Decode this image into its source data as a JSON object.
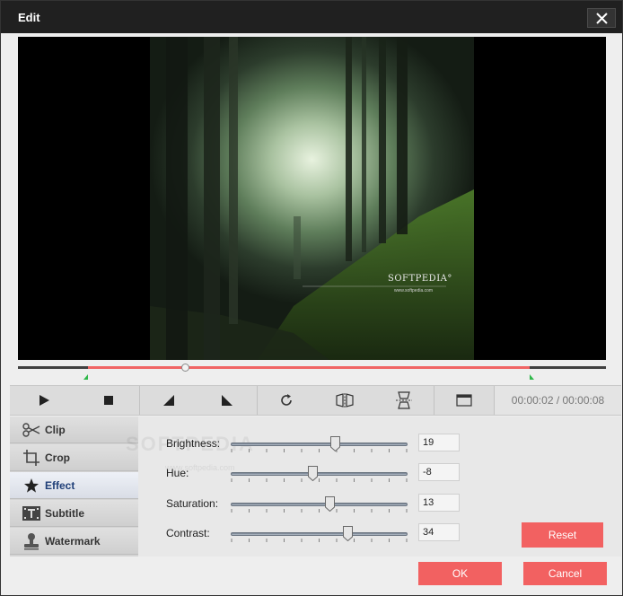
{
  "window": {
    "title": "Edit"
  },
  "preview": {
    "watermark_brand": "SOFTPEDIA°",
    "watermark_url": "www.softpedia.com"
  },
  "timeline": {
    "playhead_fraction": 0.284,
    "start_fraction": 0.119,
    "end_fraction": 0.87
  },
  "toolbar": {
    "buttons": [
      "play-icon",
      "stop-icon",
      "rotate-left-wedge-icon",
      "rotate-right-wedge-icon",
      "rotate-clockwise-icon",
      "flip-horizontal-icon",
      "flip-vertical-icon",
      "aspect-window-icon"
    ],
    "time_display": "00:00:02 / 00:00:08"
  },
  "tabs": [
    {
      "label": "Clip",
      "icon": "scissors-icon"
    },
    {
      "label": "Crop",
      "icon": "crop-icon"
    },
    {
      "label": "Effect",
      "icon": "star-icon",
      "active": true
    },
    {
      "label": "Subtitle",
      "icon": "subtitle-icon"
    },
    {
      "label": "Watermark",
      "icon": "stamp-icon"
    }
  ],
  "effects": {
    "panel_watermark": "SOFTPEDIA",
    "panel_watermark_url": "www.softpedia.com",
    "range": [
      -100,
      100
    ],
    "brightness": {
      "label": "Brightness:",
      "value": "19"
    },
    "hue": {
      "label": "Hue:",
      "value": "-8"
    },
    "saturation": {
      "label": "Saturation:",
      "value": "13"
    },
    "contrast": {
      "label": "Contrast:",
      "value": "34"
    }
  },
  "buttons": {
    "reset": "Reset",
    "ok": "OK",
    "cancel": "Cancel"
  },
  "colors": {
    "accent": "#f26161",
    "titlebar": "#202020",
    "marker": "#2fb84a"
  }
}
